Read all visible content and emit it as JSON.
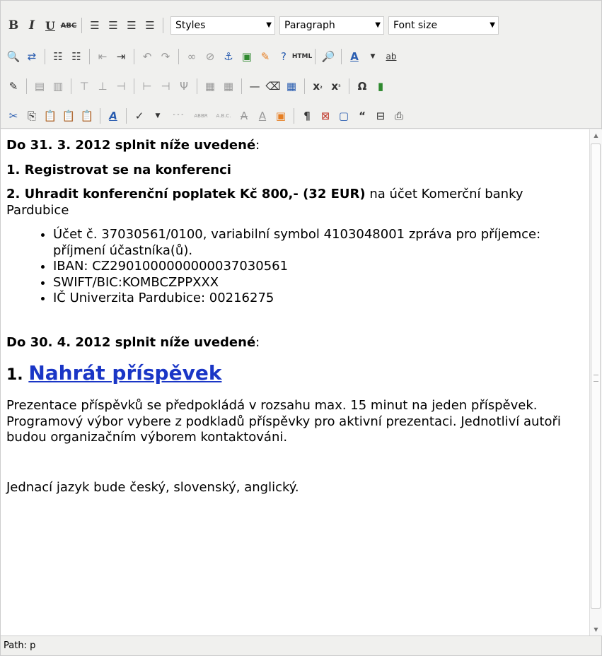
{
  "toolbar": {
    "bold": "B",
    "italic": "I",
    "underline": "U",
    "strike": "ABC",
    "styles": "Styles",
    "format": "Paragraph",
    "fontsize": "Font size",
    "html": "HTML",
    "font_color": "A",
    "bg_color": "ab",
    "sub": "x",
    "sup": "x",
    "omega": "Ω",
    "pilcrow": "¶",
    "quote": "“",
    "cite": "“ ” ”",
    "abbr": "ABBR",
    "acronym": "A.B.C.",
    "font_label": "A"
  },
  "content": {
    "p1": "Do 31. 3. 2012 splnit níže uvedené",
    "p1_colon": ":",
    "p2": "1. Registrovat se na konferenci",
    "p3_bold": "2. Uhradit konferenční poplatek Kč 800,- (32 EUR)",
    "p3_rest": " na účet Komerční banky Pardubice",
    "bullets": [
      "Účet č. 37030561/0100, variabilní symbol 4103048001 zpráva pro příjemce: příjmení účastníka(ů).",
      "IBAN: CZ2901000000000037030561",
      "SWIFT/BIC:KOMBCZPPXXX",
      "IČ Univerzita Pardubice: 00216275"
    ],
    "p4": "Do 30. 4. 2012 splnit níže uvedené",
    "p4_colon": ":",
    "h_num": "1. ",
    "h_link": "Nahrát příspěvek",
    "p5": "Prezentace příspěvků se předpokládá v rozsahu max. 15 minut na jeden příspěvek. Programový výbor vybere z podkladů příspěvky pro aktivní prezentaci. Jednotliví autoři budou organizačním výborem kontaktováni.",
    "p6": " Jednací jazyk bude český, slovenský, anglický."
  },
  "status": {
    "path": "Path: p"
  }
}
